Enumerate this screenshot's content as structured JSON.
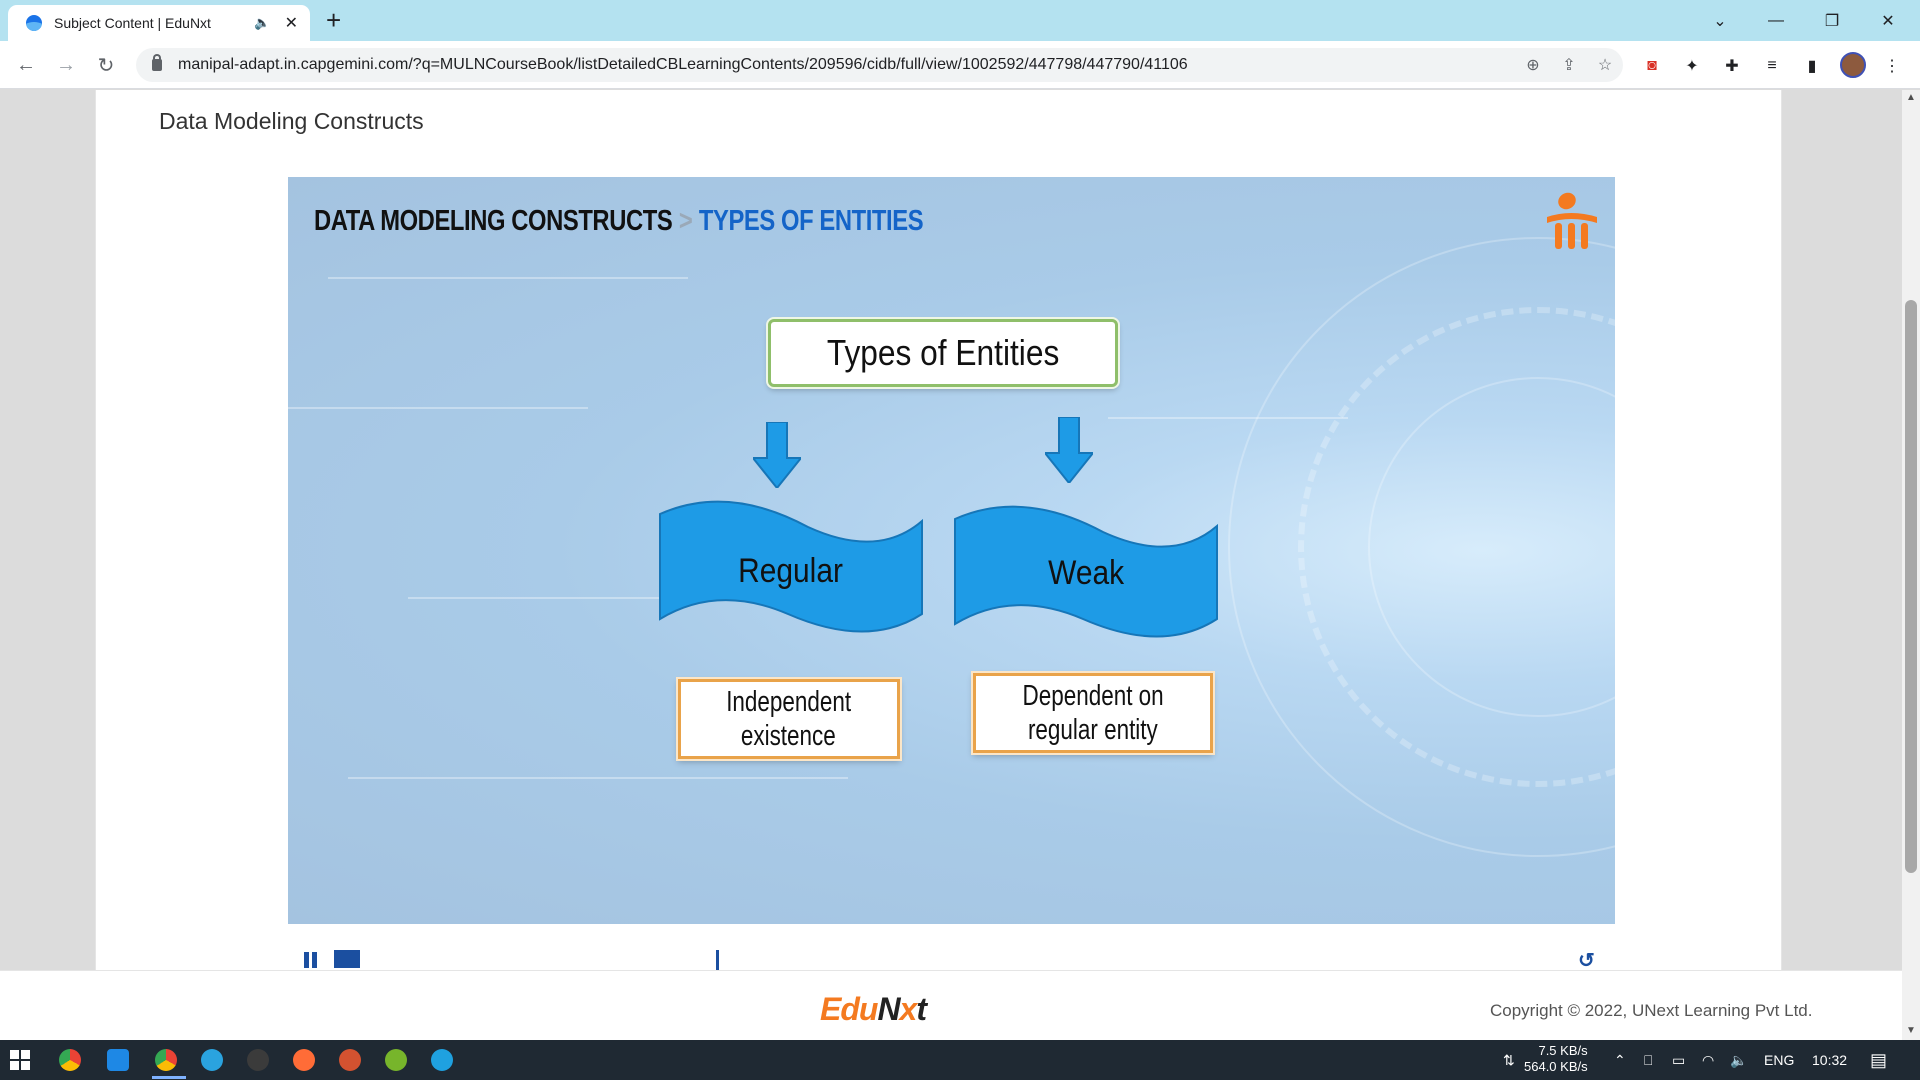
{
  "browser": {
    "tab_title": "Subject Content | EduNxt",
    "url": "manipal-adapt.in.capgemini.com/?q=MULNCourseBook/listDetailedCBLearningContents/209596/cidb/full/view/1002592/447798/447790/41106"
  },
  "page": {
    "title": "Data Modeling Constructs"
  },
  "slide": {
    "breadcrumb_main": "DATA MODELING CONSTRUCTS",
    "breadcrumb_sep": ">",
    "breadcrumb_current": "TYPES OF ENTITIES",
    "root_box": "Types of Entities",
    "left_flag": "Regular",
    "right_flag": "Weak",
    "left_desc_line1": "Independent",
    "left_desc_line2": "existence",
    "right_desc_line1": "Dependent on",
    "right_desc_line2": "regular entity",
    "colors": {
      "flag_blue": "#1e9be6",
      "heading_blue": "#1464c8",
      "root_border": "#8fbf6a",
      "desc_border": "#e9a34a",
      "logo_orange": "#f47a20"
    }
  },
  "player": {
    "progress_fraction": 0.02
  },
  "footer": {
    "brand_edu": "Edu",
    "brand_n": "N",
    "brand_x": "x",
    "brand_t": "t",
    "copyright": "Copyright © 2022, UNext Learning Pvt Ltd."
  },
  "taskbar": {
    "net_up": "7.5 KB/s",
    "net_down": "564.0 KB/s",
    "lang": "ENG",
    "time": "10:32"
  }
}
